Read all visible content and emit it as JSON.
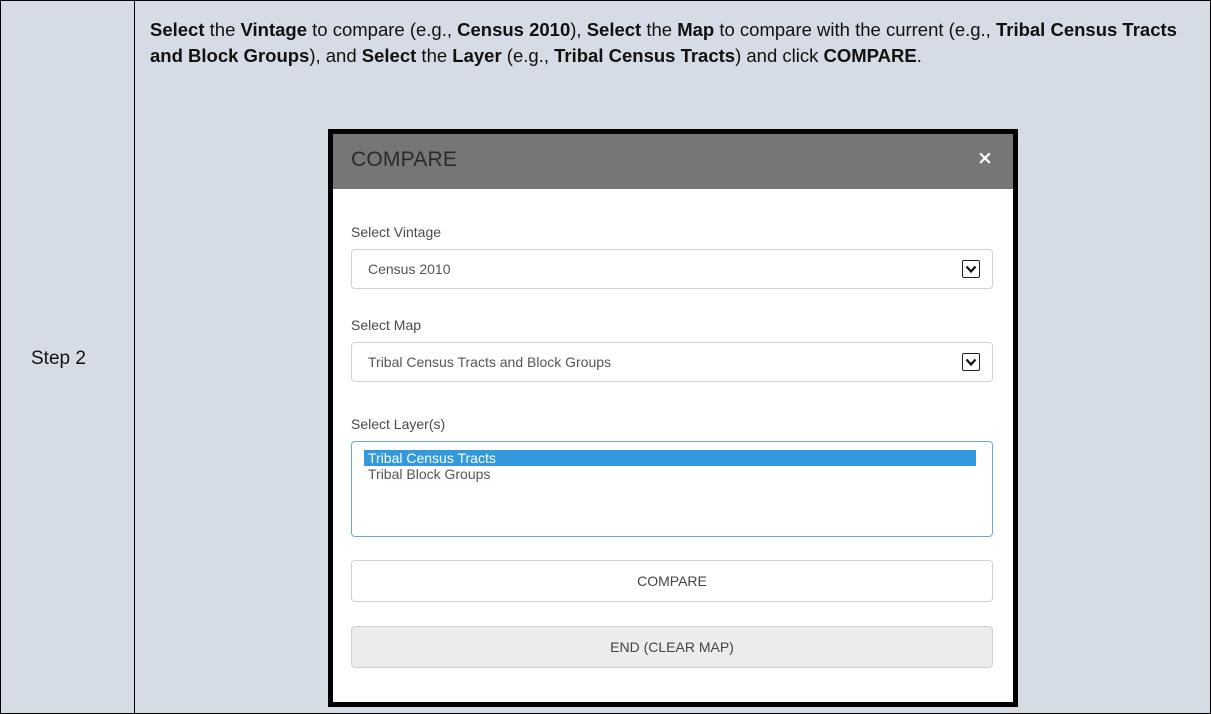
{
  "table": {
    "step_label": "Step 2",
    "instructions": [
      {
        "t": "Select",
        "b": true
      },
      {
        "t": " the ",
        "b": false
      },
      {
        "t": "Vintage",
        "b": true
      },
      {
        "t": " to compare (e.g., ",
        "b": false
      },
      {
        "t": "Census 2010",
        "b": true
      },
      {
        "t": "), ",
        "b": false
      },
      {
        "t": "Select",
        "b": true
      },
      {
        "t": " the ",
        "b": false
      },
      {
        "t": "Map",
        "b": true
      },
      {
        "t": " to compare with the current (e.g., ",
        "b": false
      },
      {
        "t": "Tribal Census Tracts and Block Groups",
        "b": true
      },
      {
        "t": "), and ",
        "b": false
      },
      {
        "t": "Select",
        "b": true
      },
      {
        "t": " the ",
        "b": false
      },
      {
        "t": "Layer",
        "b": true
      },
      {
        "t": " (e.g., ",
        "b": false
      },
      {
        "t": "Tribal Census Tracts",
        "b": true
      },
      {
        "t": ") and click ",
        "b": false
      },
      {
        "t": "COMPARE",
        "b": true
      },
      {
        "t": ".",
        "b": false
      }
    ]
  },
  "dialog": {
    "title": "COMPARE",
    "close_symbol": "×",
    "vintage": {
      "label": "Select Vintage",
      "value": "Census 2010"
    },
    "map": {
      "label": "Select Map",
      "value": "Tribal Census Tracts and Block Groups"
    },
    "layers": {
      "label": "Select Layer(s)",
      "options": [
        "Tribal Census Tracts",
        "Tribal Block Groups"
      ],
      "selected_index": 0
    },
    "compare_button": "COMPARE",
    "end_button": "END (CLEAR MAP)"
  },
  "colors": {
    "cell_background": "#d6dce5",
    "header_background": "#767676",
    "selection": "#3399dd"
  },
  "icons": {
    "close": "close-icon",
    "dropdown": "chevron-down-icon"
  }
}
